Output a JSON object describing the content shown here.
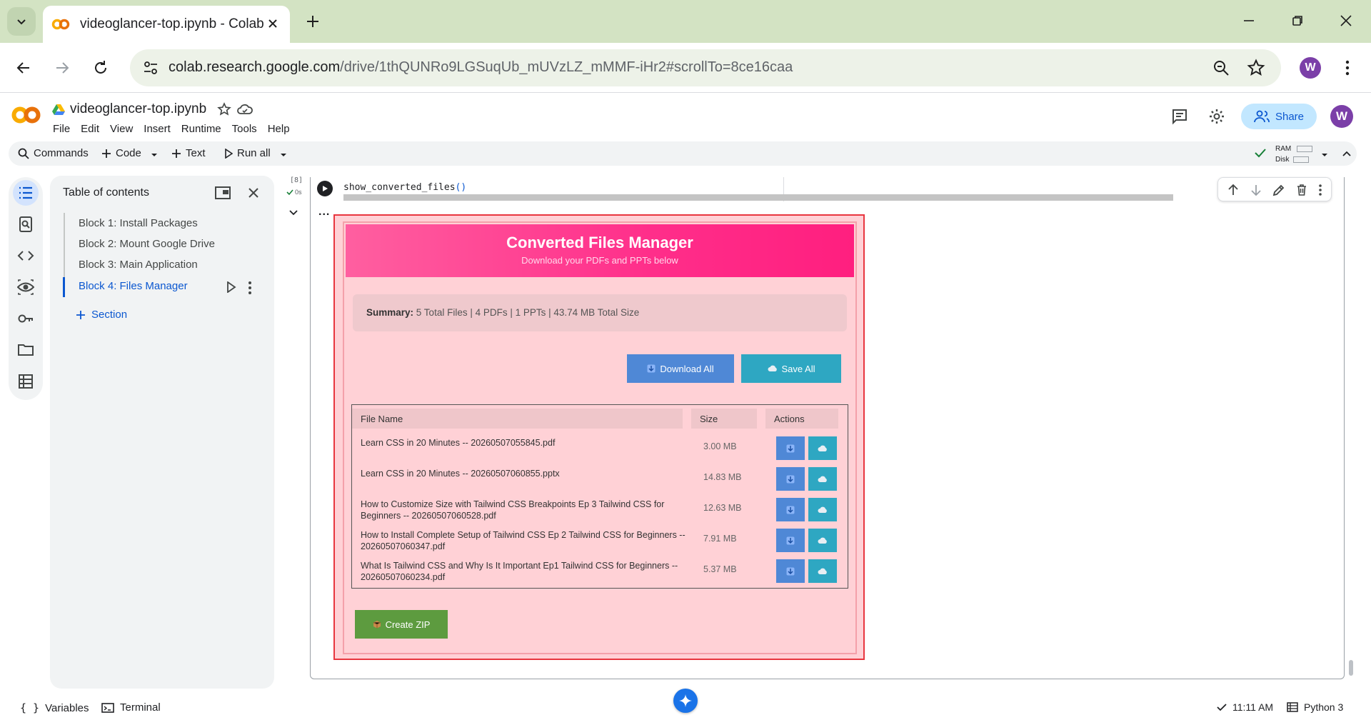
{
  "browser": {
    "tab_title": "videoglancer-top.ipynb - Colab",
    "url_host": "colab.research.google.com",
    "url_path": "/drive/1thQUNRo9LGSuqUb_mUVzLZ_mMMF-iHr2#scrollTo=8ce16caa",
    "profile_initial": "W"
  },
  "colab": {
    "doc_title": "videoglancer-top.ipynb",
    "menu": [
      "File",
      "Edit",
      "View",
      "Insert",
      "Runtime",
      "Tools",
      "Help"
    ],
    "share_label": "Share",
    "profile_initial": "W",
    "toolbar": {
      "commands": "Commands",
      "code": "Code",
      "text": "Text",
      "run_all": "Run all",
      "ram": "RAM",
      "disk": "Disk"
    }
  },
  "toc": {
    "title": "Table of contents",
    "items": [
      "Block 1: Install Packages",
      "Block 2: Mount Google Drive",
      "Block 3: Main Application",
      "Block 4: Files Manager"
    ],
    "active_index": 3,
    "add_section": "Section"
  },
  "cell": {
    "exec_count": "[8]",
    "exec_time": "0s",
    "code_fn": "show_converted_files",
    "code_parens": "()",
    "output_dots": "..."
  },
  "files_manager": {
    "title": "Converted Files Manager",
    "subtitle": "Download your PDFs and PPTs below",
    "summary_label": "Summary:",
    "summary_text": "5 Total Files | 4 PDFs | 1 PPTs | 43.74 MB Total Size",
    "download_all": "Download All",
    "save_all": "Save All",
    "columns": [
      "File Name",
      "Size",
      "Actions"
    ],
    "rows": [
      {
        "name": "Learn CSS in 20 Minutes -- 20260507055845.pdf",
        "size": "3.00 MB"
      },
      {
        "name": "Learn CSS in 20 Minutes -- 20260507060855.pptx",
        "size": "14.83 MB"
      },
      {
        "name": "How to Customize Size with Tailwind CSS Breakpoints Ep 3 Tailwind CSS for Beginners -- 20260507060528.pdf",
        "size": "12.63 MB"
      },
      {
        "name": "How to Install Complete Setup of Tailwind CSS Ep 2 Tailwind CSS for Beginners -- 20260507060347.pdf",
        "size": "7.91 MB"
      },
      {
        "name": "What Is Tailwind CSS and Why Is It Important Ep1 Tailwind CSS for Beginners -- 20260507060234.pdf",
        "size": "5.37 MB"
      }
    ],
    "create_zip": "Create ZIP",
    "colors": {
      "header": "#ff2e8a",
      "panel": "#ffd1d6",
      "border": "#e8363f",
      "download": "#4f88d6",
      "save": "#2ea7c2",
      "zip": "#5d9b3f"
    }
  },
  "status": {
    "variables": "Variables",
    "terminal": "Terminal",
    "time": "11:11 AM",
    "kernel": "Python 3"
  }
}
